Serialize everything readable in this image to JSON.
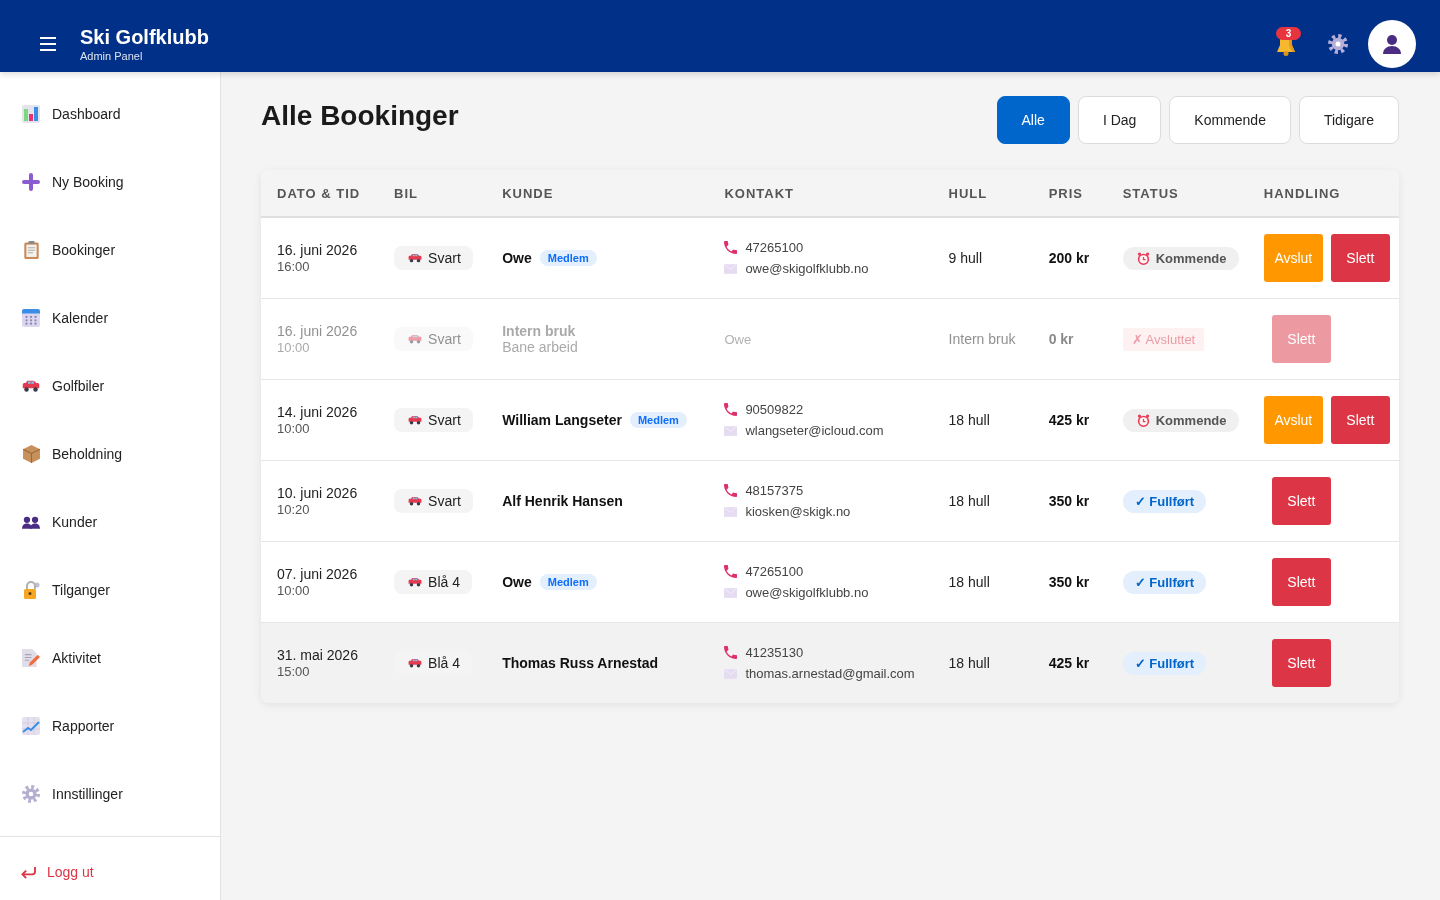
{
  "header": {
    "title": "Ski Golfklubb",
    "subtitle": "Admin Panel",
    "notification_count": "3"
  },
  "sidebar": {
    "items": [
      {
        "label": "Dashboard",
        "selected": false
      },
      {
        "label": "Ny Booking",
        "selected": false
      },
      {
        "label": "Bookinger",
        "selected": false
      },
      {
        "label": "Kalender",
        "selected": false
      },
      {
        "label": "Golfbiler",
        "selected": false
      },
      {
        "label": "Beholdning",
        "selected": false
      },
      {
        "label": "Kunder",
        "selected": false
      },
      {
        "label": "Tilganger",
        "selected": false
      },
      {
        "label": "Aktivitet",
        "selected": false
      },
      {
        "label": "Rapporter",
        "selected": false
      },
      {
        "label": "Innstillinger",
        "selected": false
      }
    ],
    "logout": "Logg ut"
  },
  "page": {
    "title": "Alle Bookinger",
    "filters": [
      {
        "label": "Alle",
        "selected": true
      },
      {
        "label": "I Dag",
        "selected": false
      },
      {
        "label": "Kommende",
        "selected": false
      },
      {
        "label": "Tidigare",
        "selected": false
      }
    ]
  },
  "table": {
    "columns": [
      "DATO & TID",
      "BIL",
      "KUNDE",
      "KONTAKT",
      "HULL",
      "PRIS",
      "STATUS",
      "HANDLING"
    ],
    "rows": [
      {
        "date": "16. juni 2026",
        "time": "16:00",
        "cart": "Svart",
        "customer": {
          "name": "Owe",
          "badge": "Medlem"
        },
        "contact": {
          "phone": "47265100",
          "email": "owe@skigolfklubb.no"
        },
        "holes": "9 hull",
        "price": "200 kr",
        "status": {
          "label": "Kommende",
          "kind": "upcoming"
        },
        "actions": [
          {
            "label": "Avslut",
            "kind": "finish"
          },
          {
            "label": "Slett",
            "kind": "delete"
          }
        ],
        "dimmed": false,
        "highlighted": false
      },
      {
        "date": "16. juni 2026",
        "time": "10:00",
        "cart": "Svart",
        "customer": {
          "name": "Intern bruk",
          "note": "Bane arbeid"
        },
        "contact": {
          "note": "Owe"
        },
        "holes": "Intern bruk",
        "price": "0 kr",
        "status": {
          "label": "✗ Avsluttet",
          "kind": "cancelled"
        },
        "actions": [
          {
            "label": "Slett",
            "kind": "delete"
          }
        ],
        "dimmed": true,
        "highlighted": false
      },
      {
        "date": "14. juni 2026",
        "time": "10:00",
        "cart": "Svart",
        "customer": {
          "name": "William Langseter",
          "badge": "Medlem"
        },
        "contact": {
          "phone": "90509822",
          "email": "wlangseter@icloud.com"
        },
        "holes": "18 hull",
        "price": "425 kr",
        "status": {
          "label": "Kommende",
          "kind": "upcoming"
        },
        "actions": [
          {
            "label": "Avslut",
            "kind": "finish"
          },
          {
            "label": "Slett",
            "kind": "delete"
          }
        ],
        "dimmed": false,
        "highlighted": false
      },
      {
        "date": "10. juni 2026",
        "time": "10:20",
        "cart": "Svart",
        "customer": {
          "name": "Alf Henrik Hansen"
        },
        "contact": {
          "phone": "48157375",
          "email": "kiosken@skigk.no"
        },
        "holes": "18 hull",
        "price": "350 kr",
        "status": {
          "label": "✓ Fullført",
          "kind": "completed"
        },
        "actions": [
          {
            "label": "Slett",
            "kind": "delete"
          }
        ],
        "dimmed": false,
        "highlighted": false
      },
      {
        "date": "07. juni 2026",
        "time": "10:00",
        "cart": "Blå 4",
        "customer": {
          "name": "Owe",
          "badge": "Medlem"
        },
        "contact": {
          "phone": "47265100",
          "email": "owe@skigolfklubb.no"
        },
        "holes": "18 hull",
        "price": "350 kr",
        "status": {
          "label": "✓ Fullført",
          "kind": "completed"
        },
        "actions": [
          {
            "label": "Slett",
            "kind": "delete"
          }
        ],
        "dimmed": false,
        "highlighted": false
      },
      {
        "date": "31. mai 2026",
        "time": "15:00",
        "cart": "Blå 4",
        "customer": {
          "name": "Thomas Russ Arnestad"
        },
        "contact": {
          "phone": "41235130",
          "email": "thomas.arnestad@gmail.com"
        },
        "holes": "18 hull",
        "price": "425 kr",
        "status": {
          "label": "✓ Fullført",
          "kind": "completed"
        },
        "actions": [
          {
            "label": "Slett",
            "kind": "delete"
          }
        ],
        "dimmed": false,
        "highlighted": true
      }
    ]
  }
}
